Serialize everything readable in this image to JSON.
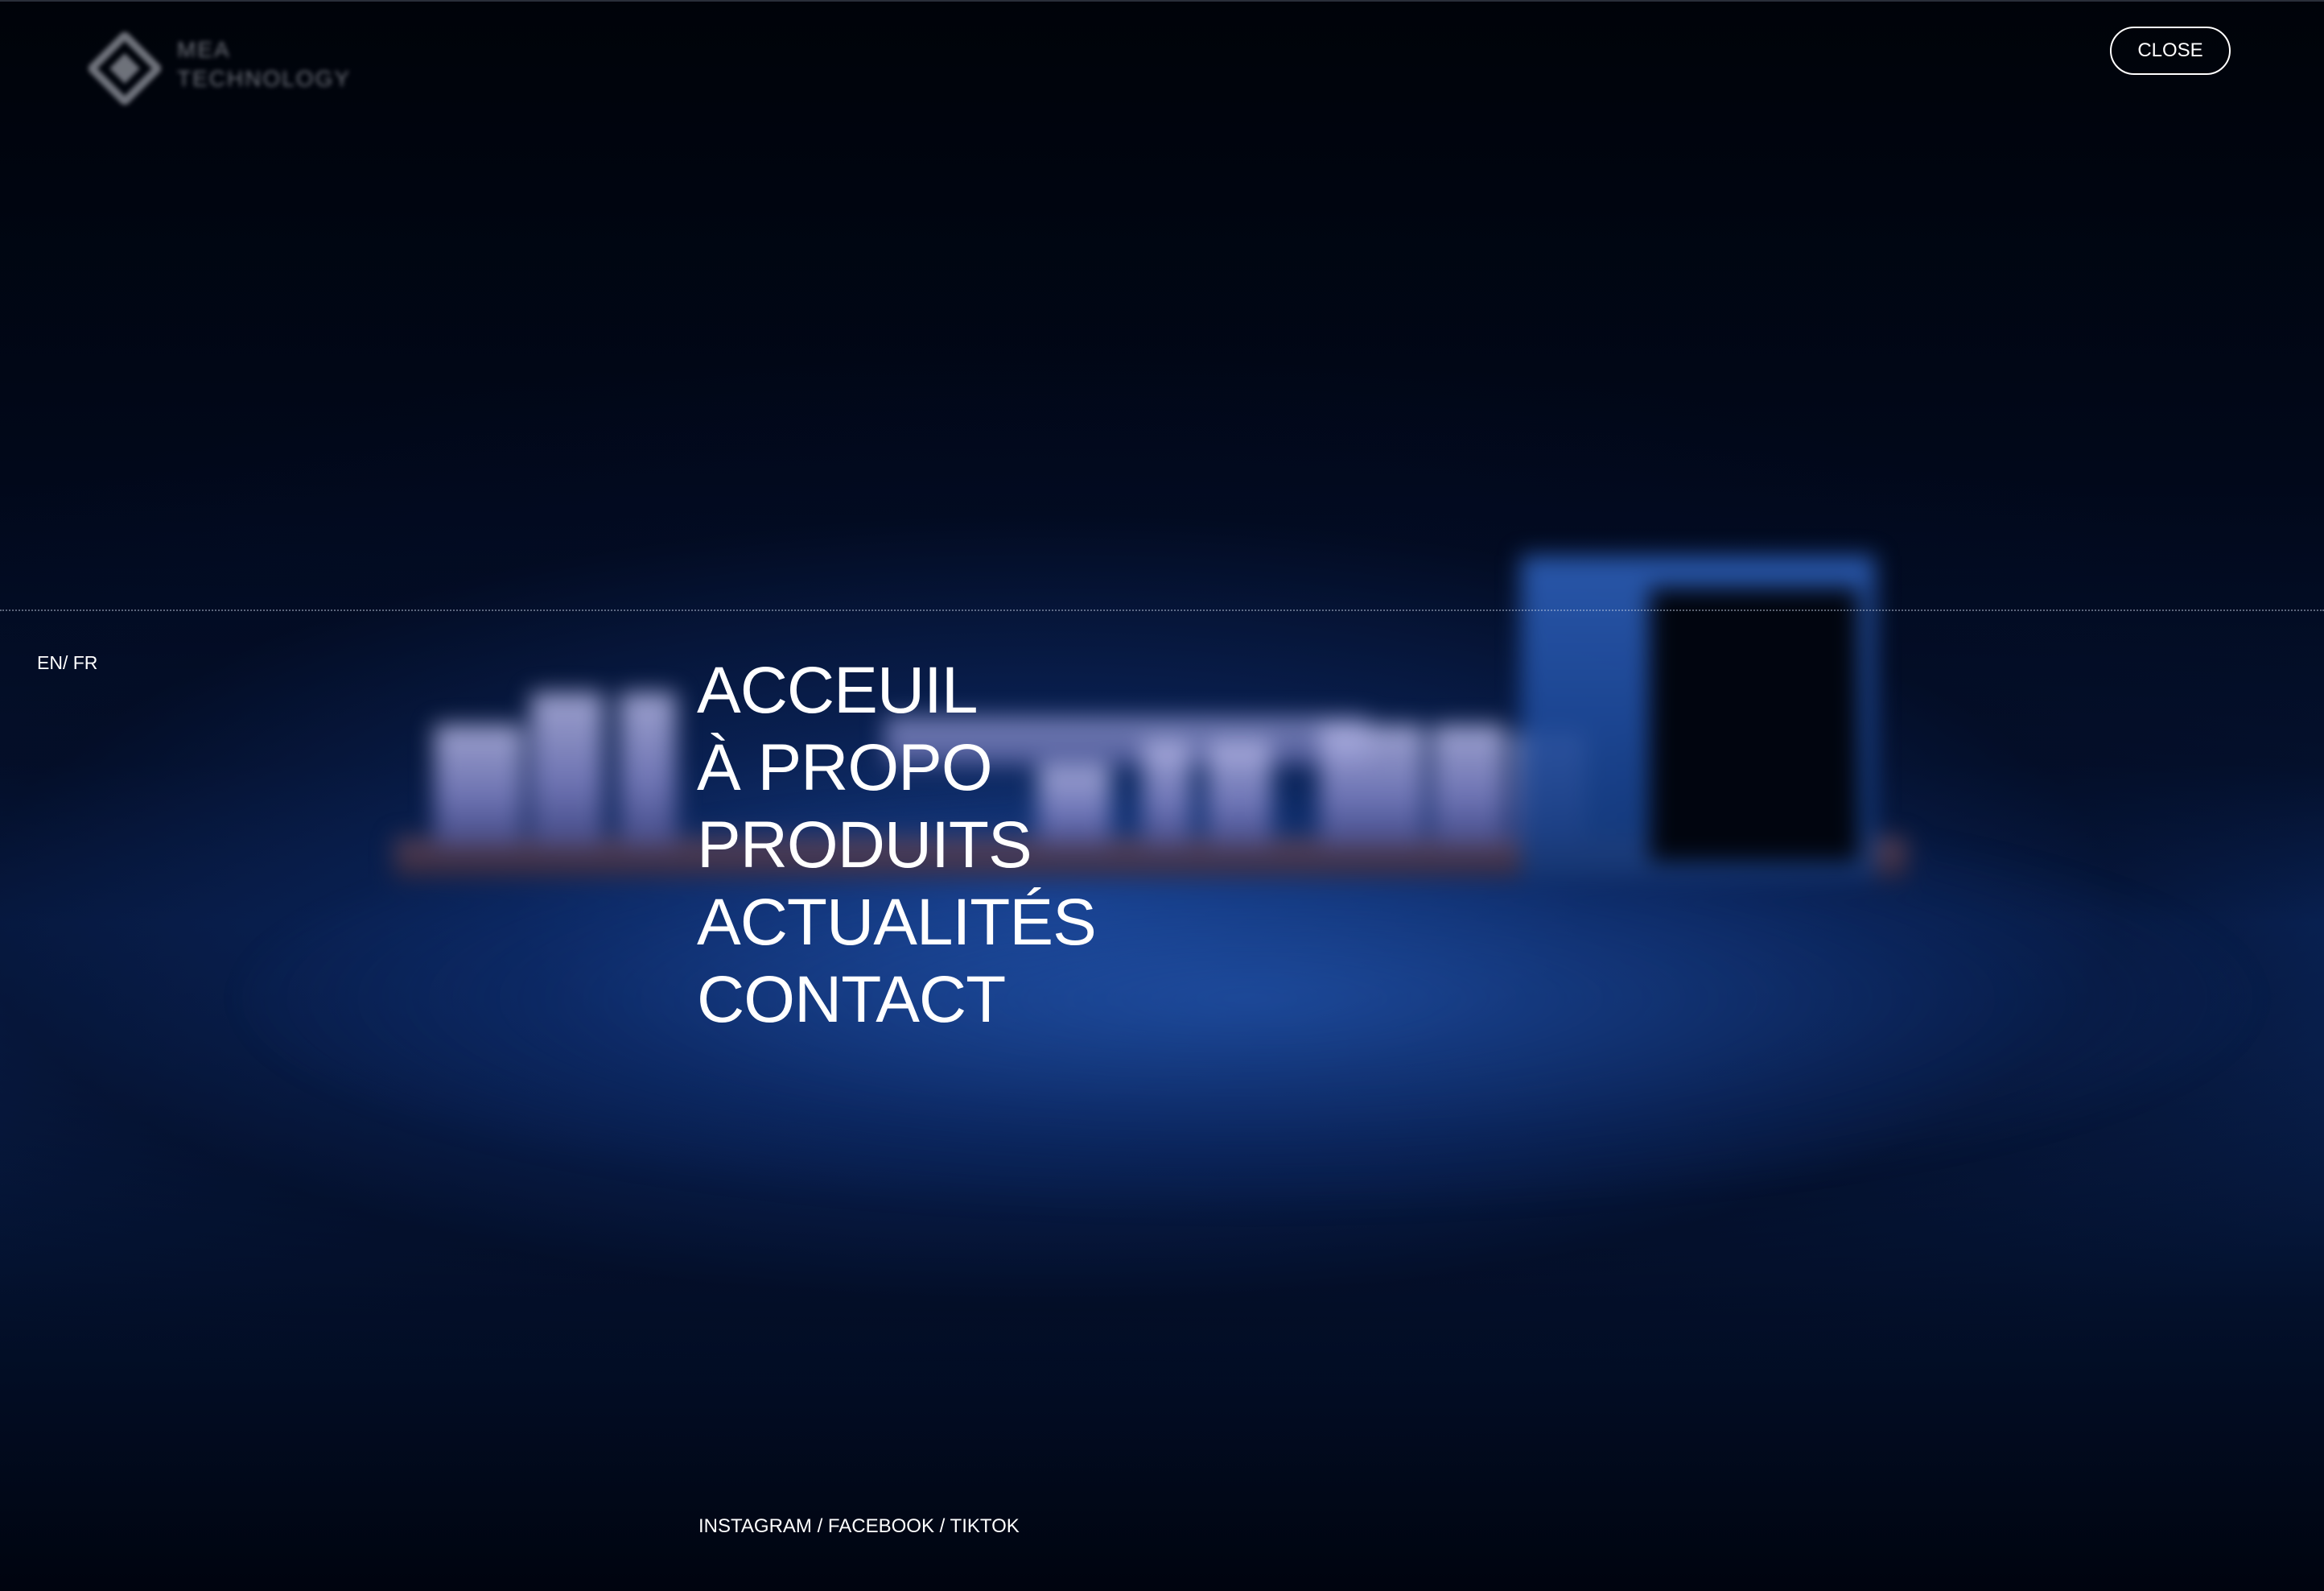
{
  "brand": {
    "name_line1": "MEA",
    "name_line2": "TECHNOLOGY",
    "logo_icon": "diamond-logo-icon"
  },
  "header": {
    "close_label": "CLOSE"
  },
  "language": {
    "en": "EN",
    "separator": "/",
    "fr": "FR"
  },
  "menu": {
    "items": [
      {
        "label": "ACCEUIL"
      },
      {
        "label": "À PROPO"
      },
      {
        "label": "PRODUITS"
      },
      {
        "label": "ACTUALITÉS"
      },
      {
        "label": "CONTACT"
      }
    ]
  },
  "socials": {
    "instagram": "INSTAGRAM",
    "facebook": "FACEBOOK",
    "tiktok": "TIKTOK",
    "separator": " / "
  },
  "colors": {
    "background": "#00030c",
    "accent_blue": "#1f4b9c",
    "text": "#ffffff"
  }
}
